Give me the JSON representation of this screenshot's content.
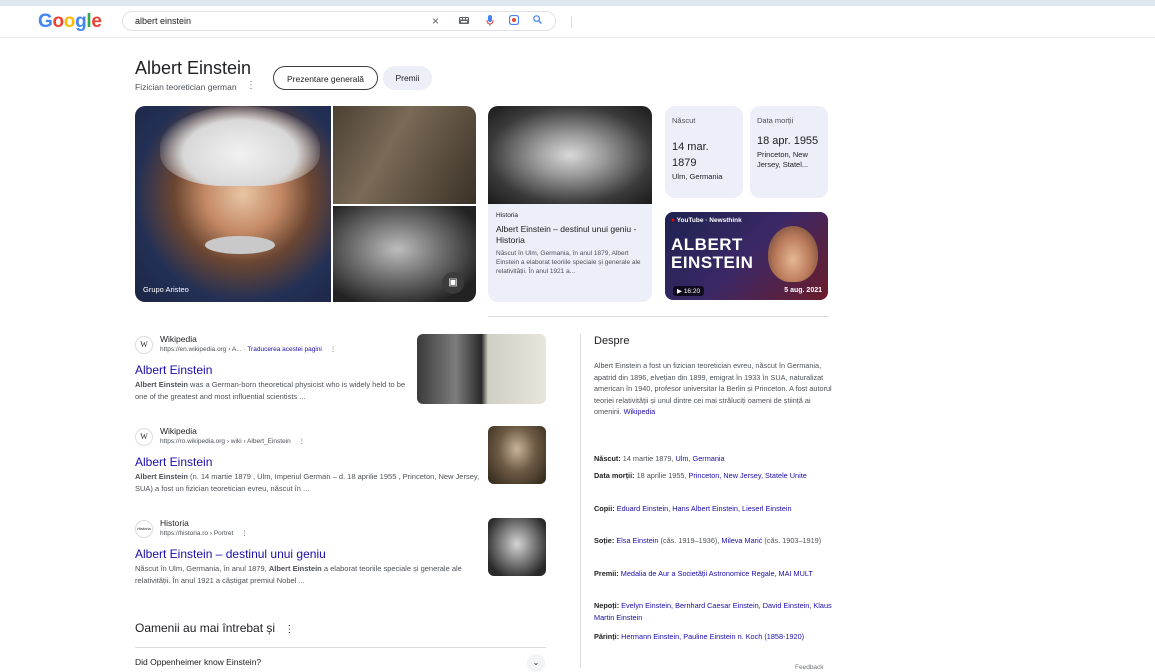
{
  "header": {
    "logo": "Google",
    "query": "albert einstein"
  },
  "entity": {
    "title": "Albert Einstein",
    "subtitle": "Fizician teoretician german",
    "tabs": [
      "Prezentare generală",
      "Premii"
    ]
  },
  "images": {
    "main_caption": "Grupo Aristeo"
  },
  "history_card": {
    "source": "Historia",
    "title": "Albert Einstein – destinul unui geniu - Historia",
    "desc": "Născut în Ulm, Germania, în anul 1879, Albert Einstein a elaborat teoriile speciale și generale ale relativității. În anul 1921 a..."
  },
  "born": {
    "label": "Născut",
    "date": "14 mar. 1879",
    "place": "Ulm, Germania"
  },
  "died": {
    "label": "Data morții",
    "date": "18 apr. 1955",
    "place": "Princeton, New Jersey, Statel..."
  },
  "video": {
    "channel": "YouTube · Newsthink",
    "title": "ALBERT EINSTEIN",
    "duration": "16:20",
    "date": "5 aug. 2021",
    "watermark": "ewsthink"
  },
  "results": [
    {
      "site": "Wikipedia",
      "favicon": "W",
      "url": "https://en.wikipedia.org › A... ·",
      "translate": "Traducerea acestei pagini",
      "title": "Albert Einstein",
      "snippet_bold": "Albert Einstein",
      "snippet": " was a German-born theoretical physicist who is widely held to be one of the greatest and most influential scientists ..."
    },
    {
      "site": "Wikipedia",
      "favicon": "W",
      "url": "https://ro.wikipedia.org › wiki › Albert_Einstein",
      "title": "Albert Einstein",
      "snippet_bold": "Albert Einstein",
      "snippet": " (n. 14 martie 1879 , Ulm, Imperiul German – d. 18 aprilie 1955 , Princeton, New Jersey, SUA) a fost un fizician teoretician evreu, născut în ..."
    },
    {
      "site": "Historia",
      "favicon": "Historia",
      "url": "https://historia.ro › Portret",
      "title": "Albert Einstein – destinul unui geniu",
      "snippet_pre": "Născut în Ulm, Germania, în anul 1879, ",
      "snippet_bold": "Albert Einstein",
      "snippet": " a elaborat teoriile speciale și generale ale relativității. În anul 1921 a câștigat premiul Nobel ..."
    }
  ],
  "paa": {
    "heading": "Oamenii au mai întrebat și",
    "questions": [
      "Did Oppenheimer know Einstein?"
    ]
  },
  "despre": {
    "heading": "Despre",
    "text": "Albert Einstein a fost un fizician teoretician evreu, născut în Germania, apatrid din 1896, elvețian din 1899, emigrat în 1933 în SUA, naturalizat american în 1940, profesor universitar la Berlin și Princeton. A fost autorul teoriei relativității și unul dintre cei mai străluciți oameni de știință ai omenirii.",
    "source": "Wikipedia",
    "facts": [
      {
        "label": "Născut:",
        "plain": " 14 martie 1879, ",
        "link": "Ulm, Germania",
        "tail": ""
      },
      {
        "label": "Data morții:",
        "plain": " 18 aprilie 1955, ",
        "link": "Princeton, New Jersey, Statele Unite",
        "tail": ""
      },
      {
        "label": "Copii:",
        "plain": " ",
        "link": "Eduard Einstein, Hans Albert Einstein, Lieserl Einstein",
        "tail": ""
      },
      {
        "label": "Soție:",
        "plain": " ",
        "link": "Elsa Einstein",
        "tail": " (căs. 1919–1936), ",
        "link2": "Mileva Marić",
        "tail2": " (căs. 1903–1919)"
      },
      {
        "label": "Premii:",
        "plain": " ",
        "link": "Medalia de Aur a Societății Astronomice Regale, MAI MULT",
        "tail": ""
      },
      {
        "label": "Nepoți:",
        "plain": " ",
        "link": "Evelyn Einstein, Bernhard Caesar Einstein, David Einstein, Klaus Martin Einstein",
        "tail": ""
      },
      {
        "label": "Părinți:",
        "plain": " ",
        "link": "Hermann Einstein, Pauline Einstein n. Koch (1858-1920)",
        "tail": ""
      }
    ],
    "feedback": "Feedback"
  },
  "colors": {
    "link": "#1a0dab",
    "chip_bg": "#eceef8",
    "text": "#202124",
    "muted": "#4d5156"
  }
}
